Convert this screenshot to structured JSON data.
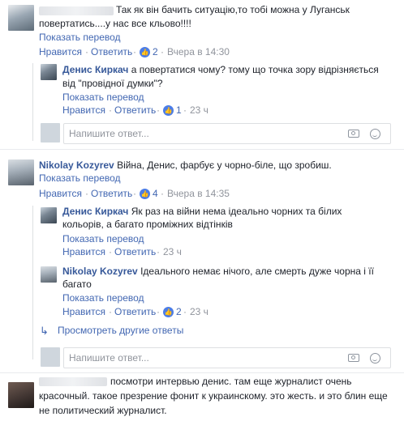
{
  "c1": {
    "text_line1": "Так як він бачить ситуацію,то тобі можна у Луганськ",
    "text_line2": "повертатись....у нас все кльово!!!!",
    "translate": "Показать перевод",
    "like": "Нравится",
    "reply": "Ответить",
    "likes": "2",
    "time": "Вчера в 14:30"
  },
  "r1": {
    "name": "Денис Киркач",
    "text_line1": "а повертатися чому? тому що точка зору відрізняється",
    "text_line2": "від \"провідної думки\"?",
    "translate": "Показать перевод",
    "like": "Нравится",
    "reply": "Ответить",
    "likes": "1",
    "time": "23 ч"
  },
  "reply_box_placeholder": "Напишите ответ...",
  "c2": {
    "name": "Nikolay Kozyrev",
    "text": "Війна, Денис, фарбує у чорно-біле, що зробиш.",
    "translate": "Показать перевод",
    "like": "Нравится",
    "reply": "Ответить",
    "likes": "4",
    "time": "Вчера в 14:35"
  },
  "r2": {
    "name": "Денис Киркач",
    "text_line1": "Як раз на війни нема ідеально чорних та білих",
    "text_line2": "кольорів, а багато проміжних відтінків",
    "translate": "Показать перевод",
    "like": "Нравится",
    "reply": "Ответить",
    "time": "23 ч"
  },
  "r3": {
    "name": "Nikolay Kozyrev",
    "text_line1": "Ідеального немає нічого, але смерть дуже чорна і її",
    "text_line2": "багато",
    "translate": "Показать перевод",
    "like": "Нравится",
    "reply": "Ответить",
    "likes": "2",
    "time": "23 ч"
  },
  "more_replies": "Просмотреть другие ответы",
  "c3": {
    "text_line1": "посмотри интервью денис. там еще журналист очень",
    "text_line2": "красочный. такое презрение фонит к украинскому. это жесть. и это блин еще",
    "text_line3": "не политический журналист."
  },
  "icons": {
    "like": "thumbs-up-icon",
    "camera": "camera-icon",
    "emoji": "emoji-icon",
    "reply_arrow": "reply-arrow-icon"
  },
  "colors": {
    "link": "#4267b2",
    "name": "#365899",
    "meta": "#90949c",
    "like_badge": "#4c7de6"
  }
}
